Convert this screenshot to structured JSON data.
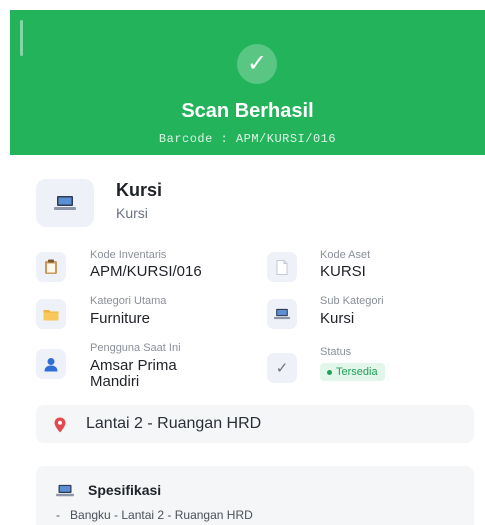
{
  "header": {
    "title": "Scan Berhasil",
    "barcode": "Barcode : APM/KURSI/016",
    "color": "#22b35b",
    "icon": "check-icon"
  },
  "item": {
    "name": "Kursi",
    "subtitle": "Kursi",
    "icon": "laptop-icon"
  },
  "fields": {
    "kode_inventaris": {
      "label": "Kode Inventaris",
      "value": "APM/KURSI/016",
      "icon": "clipboard-icon"
    },
    "kode_aset": {
      "label": "Kode Aset",
      "value": "KURSI",
      "icon": "document-icon"
    },
    "kategori_utama": {
      "label": "Kategori Utama",
      "value": "Furniture",
      "icon": "folder-icon"
    },
    "sub_kategori": {
      "label": "Sub Kategori",
      "value": "Kursi",
      "icon": "laptop-icon"
    },
    "pengguna": {
      "label": "Pengguna Saat Ini",
      "value_line1": "Amsar Prima",
      "value_line2": "Mandiri",
      "icon": "user-icon"
    },
    "status": {
      "label": "Status",
      "value": "Tersedia",
      "icon": "check-icon",
      "color": "#22a057"
    }
  },
  "location": {
    "text": "Lantai 2 - Ruangan HRD",
    "icon": "pin-icon"
  },
  "spec": {
    "title": "Spesifikasi",
    "items": [
      "Bangku - Lantai 2 - Ruangan HRD"
    ],
    "bullet": "-",
    "icon": "laptop-icon"
  }
}
